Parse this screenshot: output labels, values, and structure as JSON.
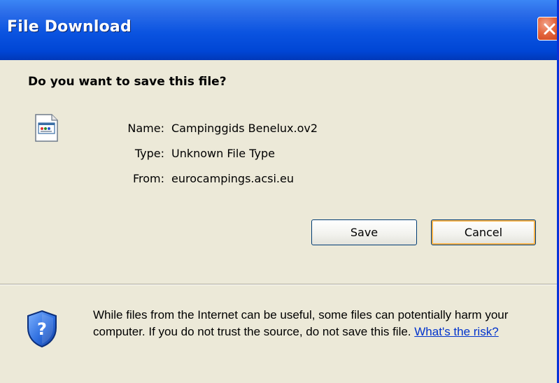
{
  "dialog": {
    "title": "File Download",
    "question": "Do you want to save this file?",
    "fields": [
      {
        "label": "Name:",
        "value": "Campinggids Benelux.ov2"
      },
      {
        "label": "Type:",
        "value": "Unknown File Type"
      },
      {
        "label": "From:",
        "value": "eurocampings.acsi.eu"
      }
    ],
    "buttons": {
      "save": "Save",
      "cancel": "Cancel"
    },
    "warning": {
      "text": "While files from the Internet can be useful, some files can potentially harm your computer. If you do not trust the source, do not save this file.",
      "link": "What's the risk?"
    }
  },
  "icons": {
    "close": "close-icon",
    "file": "file-icon",
    "shield": "shield-question-icon"
  },
  "colors": {
    "titlebar": "#0a53e0",
    "close": "#e5663d",
    "dialog_bg": "#ece9d8",
    "link": "#0033cc",
    "button_border": "#003c74",
    "focus": "#f8b34a"
  }
}
